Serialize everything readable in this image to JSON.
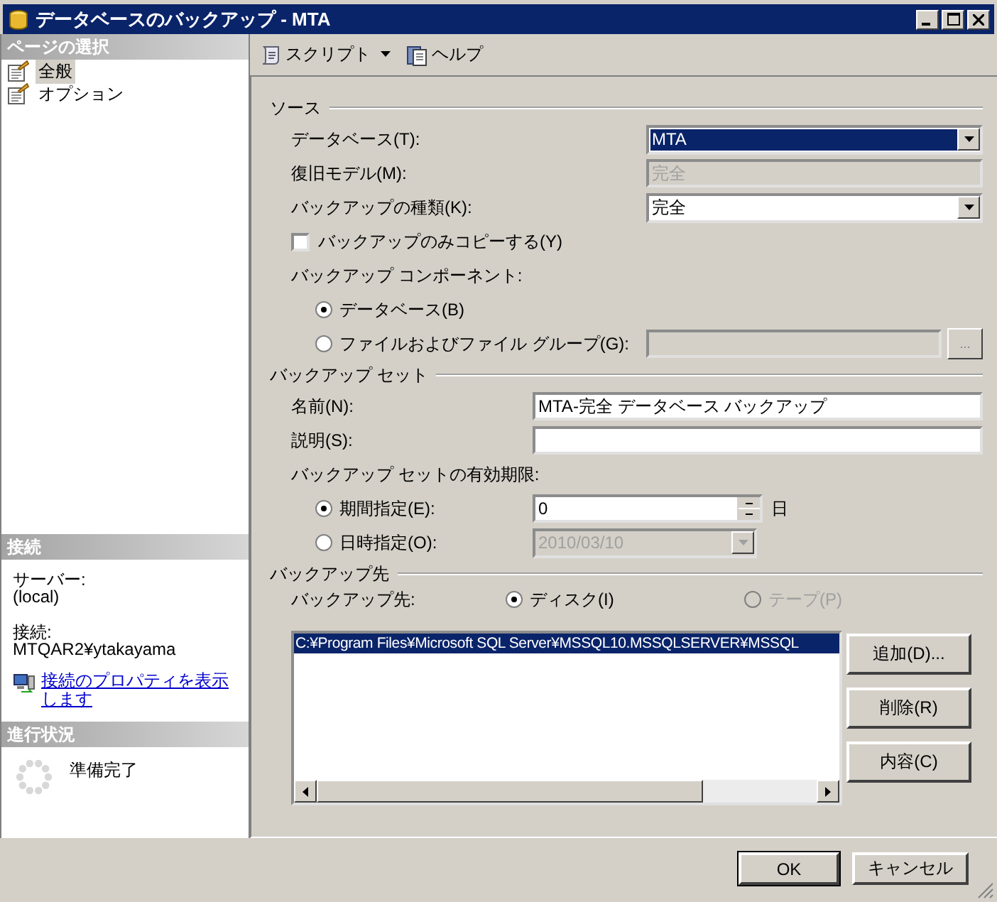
{
  "window": {
    "title": "データベースのバックアップ - MTA"
  },
  "sidebar": {
    "header": "ページの選択",
    "items": [
      {
        "label": "全般",
        "selected": true
      },
      {
        "label": "オプション",
        "selected": false
      }
    ]
  },
  "connection": {
    "header": "接続",
    "server_label": "サーバー:",
    "server": "(local)",
    "connection_label": "接続:",
    "connection": "MTQAR2¥ytakayama",
    "link": "接続のプロパティを表示します"
  },
  "progress": {
    "header": "進行状況",
    "status": "準備完了"
  },
  "toolbar": [
    {
      "label": "スクリプト",
      "kind": "script"
    },
    {
      "label": "ヘルプ",
      "kind": "help"
    }
  ],
  "source": {
    "title": "ソース",
    "database": {
      "label": "データベース(T):",
      "value": "MTA",
      "focused": true
    },
    "recovery_model": {
      "label": "復旧モデル(M):",
      "value": "完全"
    },
    "backup_type": {
      "label": "バックアップの種類(K):",
      "value": "完全",
      "focused": false
    },
    "copy_only": {
      "label": "バックアップのみコピーする(Y)",
      "checked": false
    },
    "components_label": "バックアップ コンポーネント:",
    "components": [
      {
        "label": "データベース(B)",
        "selected": true
      },
      {
        "label": "ファイルおよびファイル グループ(G):",
        "selected": false
      }
    ],
    "browse_label": "..."
  },
  "backup_set": {
    "title": "バックアップ セット",
    "name": {
      "label": "名前(N):",
      "value": "MTA-完全 データベース バックアップ"
    },
    "description": {
      "label": "説明(S):"
    },
    "expiry_label": "バックアップ セットの有効期限:",
    "expiry": [
      {
        "label": "期間指定(E):",
        "kind": "days",
        "value": "0",
        "unit": "日",
        "selected": true
      },
      {
        "label": "日時指定(O):",
        "kind": "date",
        "value": "2010/03/10",
        "selected": false
      }
    ]
  },
  "destination": {
    "title": "バックアップ先",
    "label": "バックアップ先:",
    "media": [
      {
        "label": "ディスク(I)",
        "selected": true,
        "disabled": false
      },
      {
        "label": "テープ(P)",
        "selected": false,
        "disabled": true
      }
    ],
    "files": [
      {
        "path": "C:¥Program Files¥Microsoft SQL Server¥MSSQL10.MSSQLSERVER¥MSSQL",
        "selected": true
      }
    ],
    "buttons": [
      "追加(D)...",
      "削除(R)",
      "内容(C)"
    ]
  },
  "footer": [
    {
      "label": "OK",
      "default": true
    },
    {
      "label": "キャンセル",
      "default": false
    }
  ]
}
